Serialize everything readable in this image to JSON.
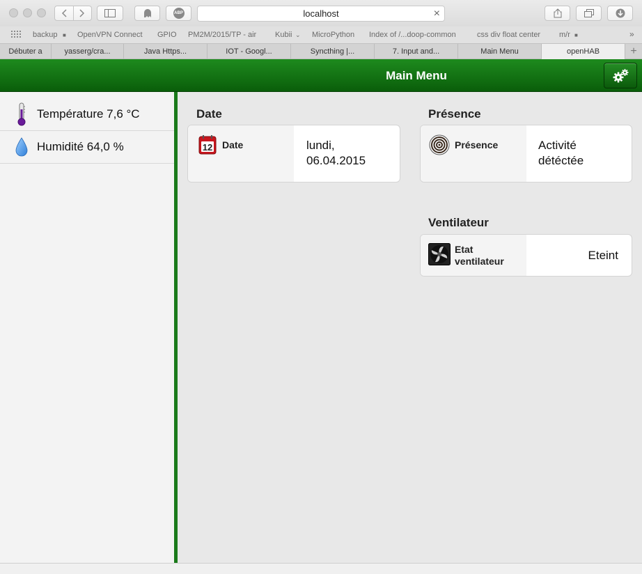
{
  "browser": {
    "url": "localhost",
    "bookmarks": [
      "backup",
      "OpenVPN Connect",
      "GPIO",
      "PM2M/2015/TP - air",
      "Kubii",
      "MicroPython",
      "Index of /...doop-common",
      "css div float center",
      "m/r"
    ],
    "tabs": [
      "Débuter a",
      "yasserg/cra...",
      "Java Https...",
      "IOT - Googl...",
      "Syncthing |...",
      "7. Input and...",
      "Main Menu",
      "openHAB"
    ],
    "active_tab": "openHAB",
    "abp_label": "ABP"
  },
  "header": {
    "title": "Main Menu",
    "settings_icon": "gears-icon"
  },
  "sidebar": {
    "items": [
      {
        "label": "Température 7,6 °C",
        "icon": "thermometer-icon"
      },
      {
        "label": "Humidité 64,0 %",
        "icon": "water-drop-icon"
      }
    ]
  },
  "sections": {
    "date": {
      "title": "Date",
      "item_name": "Date",
      "value_line1": "lundi,",
      "value_line2": "06.04.2015",
      "calendar_day": "12"
    },
    "presence": {
      "title": "Présence",
      "item_name": "Présence",
      "value_line1": "Activité",
      "value_line2": "détéctée"
    },
    "fan": {
      "title": "Ventilateur",
      "item_name_line1": "Etat",
      "item_name_line2": "ventilateur",
      "value": "Eteint"
    }
  },
  "colors": {
    "header_green": "#137513",
    "divider_green": "#1a7a1a"
  }
}
